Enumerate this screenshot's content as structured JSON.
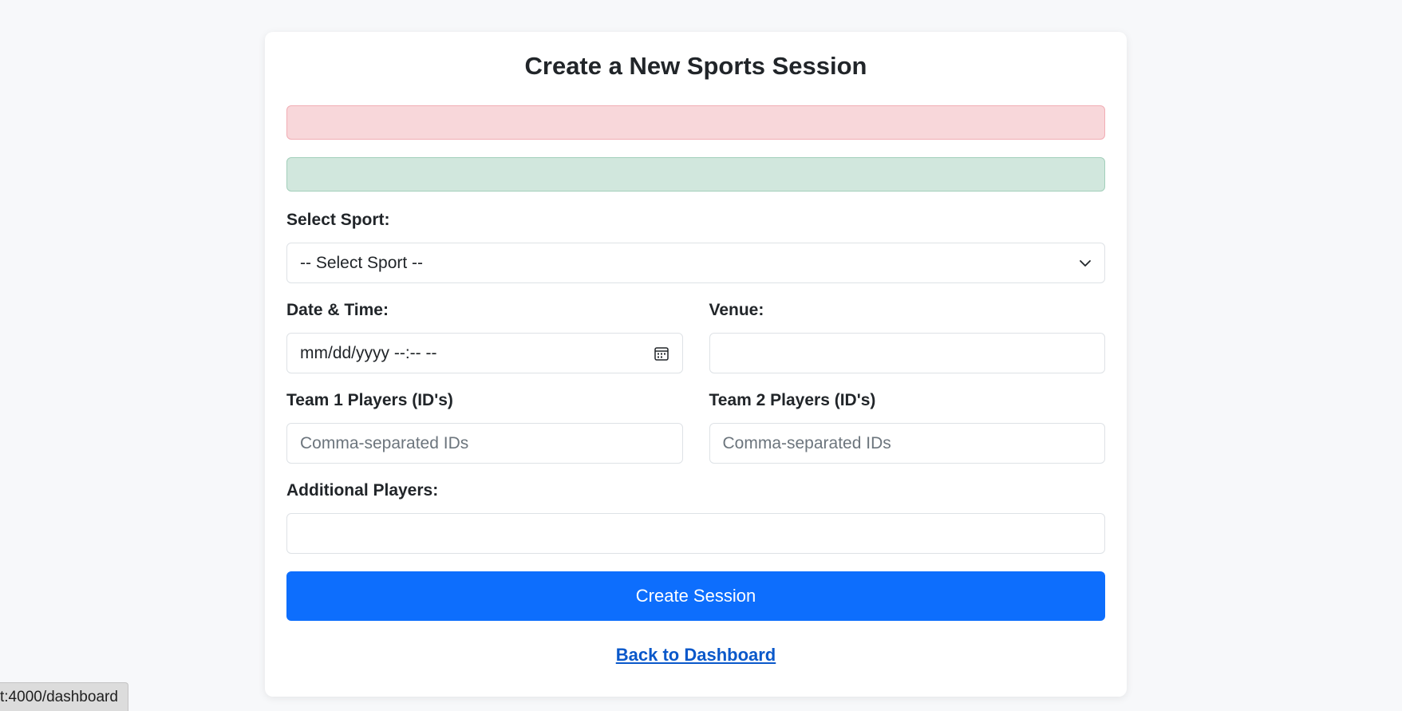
{
  "form": {
    "title": "Create a New Sports Session",
    "error_message": "",
    "success_message": "",
    "sport": {
      "label": "Select Sport:",
      "selected": "-- Select Sport --",
      "icon": "chevron-down-icon"
    },
    "datetime": {
      "label": "Date & Time:",
      "value": "mm/dd/yyyy --:-- --",
      "icon": "calendar-icon"
    },
    "venue": {
      "label": "Venue:",
      "value": ""
    },
    "team1": {
      "label": "Team 1 Players (ID's)",
      "placeholder": "Comma-separated IDs",
      "value": ""
    },
    "team2": {
      "label": "Team 2 Players (ID's)",
      "placeholder": "Comma-separated IDs",
      "value": ""
    },
    "additional": {
      "label": "Additional Players:",
      "value": ""
    },
    "submit_label": "Create Session",
    "back_link": "Back to Dashboard"
  },
  "status_bar": {
    "url": "t:4000/dashboard"
  },
  "colors": {
    "primary": "#0d6efd",
    "error_bg": "#f8d7da",
    "success_bg": "#d1e7dd",
    "page_bg": "#f7f8fa"
  }
}
